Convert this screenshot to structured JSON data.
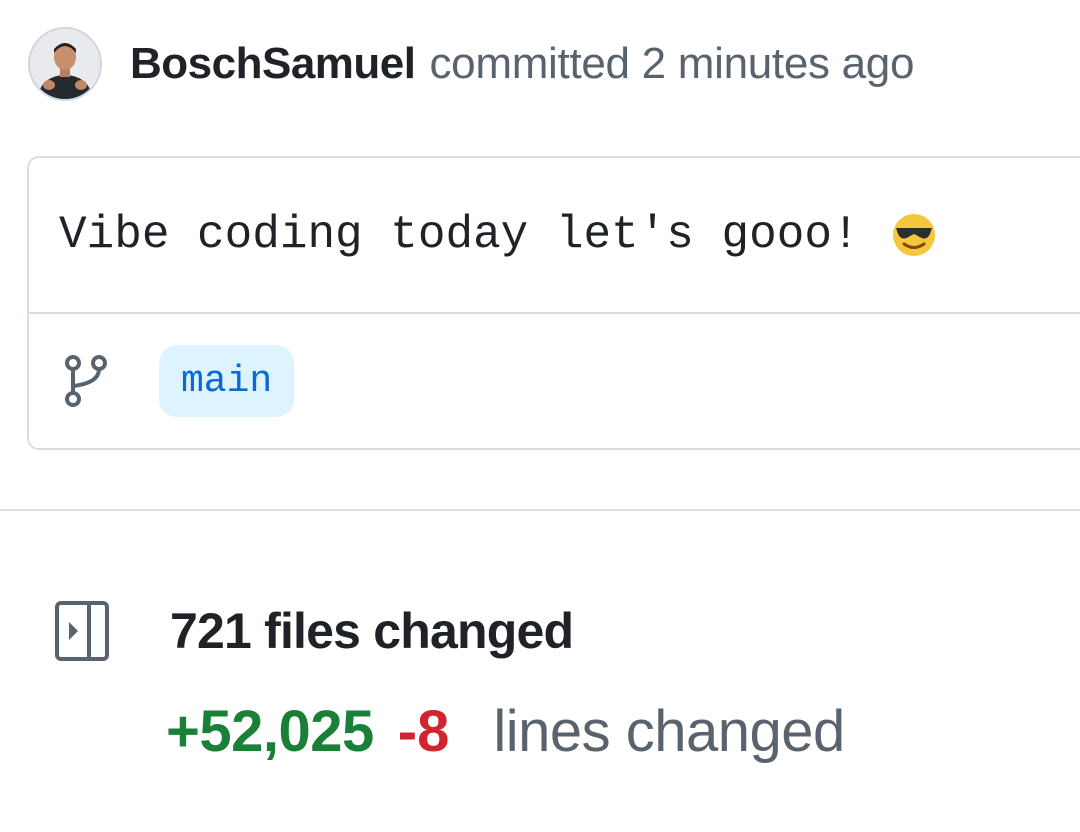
{
  "commit": {
    "author": "BoschSamuel",
    "action_text": "committed 2 minutes ago",
    "message": "Vibe coding today let's gooo!",
    "message_emoji": "smiling-face-with-sunglasses",
    "branch": "main"
  },
  "stats": {
    "files_changed": "721 files changed",
    "additions": "+52,025",
    "deletions": "-8",
    "lines_label": "lines changed"
  },
  "icons": {
    "avatar": "user-avatar",
    "branch": "git-branch-icon",
    "files": "sidebar-expand-icon",
    "emoji": "sunglasses-emoji-icon"
  },
  "colors": {
    "addition_green": "#1a7f37",
    "deletion_red": "#d1242f",
    "branch_blue": "#0969da",
    "branch_bg": "#ddf4ff",
    "muted_text": "#59636e"
  }
}
